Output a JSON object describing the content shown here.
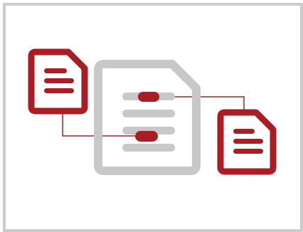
{
  "illustration": {
    "icon_name": "document-linking-icon",
    "colors": {
      "accent": "#a81e24",
      "gray": "#c8c8c8",
      "frame": "#cbcbcb",
      "background": "#ffffff"
    }
  }
}
